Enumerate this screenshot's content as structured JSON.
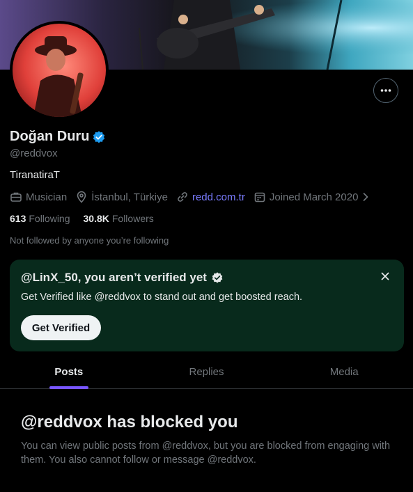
{
  "profile": {
    "name": "Doğan Duru",
    "handle": "@reddvox",
    "bio": "TiranatiraT",
    "profession": "Musician",
    "location": "İstanbul, Türkiye",
    "website": "redd.com.tr",
    "joined": "Joined March 2020",
    "following_count": "613",
    "following_label": "Following",
    "followers_count": "30.8K",
    "followers_label": "Followers",
    "not_followed_text": "Not followed by anyone you’re following"
  },
  "verify_card": {
    "title": "@LinX_50, you aren’t verified yet",
    "subtitle": "Get Verified like @reddvox to stand out and get boosted reach.",
    "button_label": "Get Verified"
  },
  "tabs": [
    {
      "label": "Posts"
    },
    {
      "label": "Replies"
    },
    {
      "label": "Media"
    }
  ],
  "blocked": {
    "title": "@reddvox has blocked you",
    "text": "You can view public posts from @reddvox, but you are blocked from engaging with them. You also cannot follow or message @reddvox."
  },
  "colors": {
    "accent": "#7856ff",
    "link": "#7a7cff",
    "verified_badge": "#1d9bf0",
    "card_bg": "#082a1c",
    "muted_text": "#71767b"
  },
  "icons": {
    "more": "more-horizontal-icon",
    "verified": "verified-badge-icon",
    "profession": "briefcase-icon",
    "location": "location-pin-icon",
    "website": "link-icon",
    "joined": "calendar-icon",
    "expand": "chevron-right-icon",
    "close": "close-icon"
  }
}
